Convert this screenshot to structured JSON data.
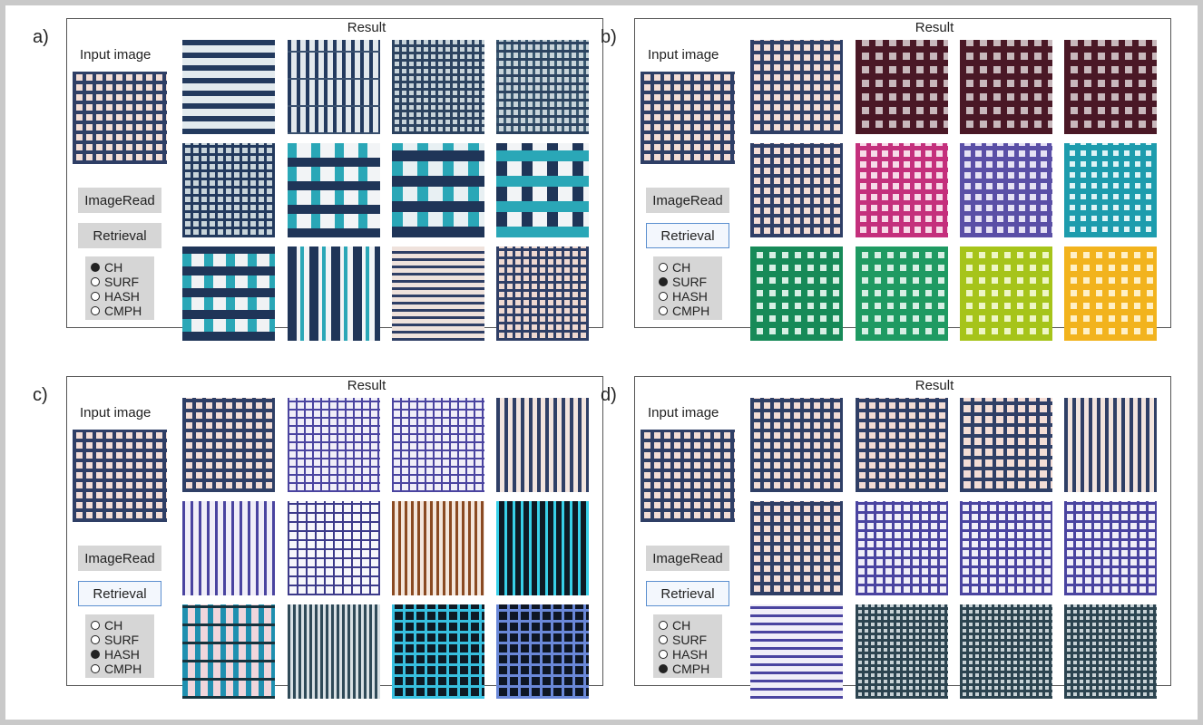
{
  "result_label": "Result",
  "input_label": "Input image",
  "imageread_label": "ImageRead",
  "retrieval_label": "Retrieval",
  "methods": [
    "CH",
    "SURF",
    "HASH",
    "CMPH"
  ],
  "input_pattern": {
    "bg": "#f3ddd6",
    "h": "#2f3f66",
    "v": "#2f3f66",
    "hs": 11,
    "vs": 11,
    "hw": 4,
    "vw": 4
  },
  "panels": [
    {
      "letter": "a)",
      "selected_method": "CH",
      "retrieval_active": false,
      "results": [
        {
          "bg": "#e2eaee",
          "h": "#233a5e",
          "v": null,
          "hs": 14,
          "hw": 6
        },
        {
          "bg": "#e2e8ec",
          "h": "#39506e",
          "v": "#233a5e",
          "hs": 30,
          "vs": 10,
          "hw": 2,
          "vw": 4
        },
        {
          "bg": "#c8d4da",
          "h": "#2c4360",
          "v": "#2c4360",
          "hs": 8,
          "vs": 8,
          "hw": 3,
          "vw": 3
        },
        {
          "bg": "#c8d4da",
          "h": "#2c4360",
          "v": "#3a5870",
          "hs": 9,
          "vs": 8,
          "hw": 3,
          "vw": 3
        },
        {
          "bg": "#c8d4da",
          "h": "#233a5e",
          "v": "#233a5e",
          "hs": 9,
          "vs": 9,
          "hw": 3,
          "vw": 3
        },
        {
          "bg": "#f2f4f6",
          "h": "#1f3558",
          "v": "#2aa7b7",
          "hs": 26,
          "vs": 26,
          "hw": 10,
          "vw": 10
        },
        {
          "bg": "#e8f0f3",
          "h": "#1f3558",
          "v": "#2aa7b7",
          "hs": 28,
          "vs": 28,
          "hw": 12,
          "vw": 12
        },
        {
          "bg": "#f2f4f6",
          "h": "#2aa7b7",
          "v": "#1f3558",
          "hs": 28,
          "vs": 28,
          "hw": 12,
          "vw": 12
        },
        {
          "bg": "#f0f2f4",
          "h": "#1f3558",
          "v": "#2aa7b7",
          "hs": 24,
          "vs": 24,
          "hw": 10,
          "vw": 10
        },
        {
          "bg": "#f2f4f6",
          "h": null,
          "v": "#1f3558",
          "vs": 24,
          "vw": 10,
          "accent": "#2aa7b7"
        },
        {
          "bg": "#efe2dc",
          "h": "#2f3f66",
          "v": null,
          "hs": 8,
          "hw": 3
        },
        {
          "bg": "#efd9d1",
          "h": "#2f3f66",
          "v": "#2f3f66",
          "hs": 9,
          "vs": 9,
          "hw": 3,
          "vw": 3
        }
      ]
    },
    {
      "letter": "b)",
      "selected_method": "SURF",
      "retrieval_active": true,
      "results": [
        {
          "bg": "#f3ddd6",
          "h": "#2f3f66",
          "v": "#2f3f66",
          "hs": 11,
          "vs": 11,
          "hw": 4,
          "vw": 4
        },
        {
          "bg": "#c8b8bc",
          "h": "#4a1826",
          "v": "#4a1826",
          "hs": 15,
          "vs": 15,
          "hw": 7,
          "vw": 7
        },
        {
          "bg": "#c8b8bc",
          "h": "#4a1826",
          "v": "#4a1826",
          "hs": 15,
          "vs": 15,
          "hw": 7,
          "vw": 7
        },
        {
          "bg": "#c8b8bc",
          "h": "#4a1826",
          "v": "#4a1826",
          "hs": 15,
          "vs": 15,
          "hw": 7,
          "vw": 7
        },
        {
          "bg": "#f3ddd6",
          "h": "#2f3f66",
          "v": "#2f3f66",
          "hs": 11,
          "vs": 11,
          "hw": 4,
          "vw": 4
        },
        {
          "bg": "#f7dbe8",
          "h": "#c4307c",
          "v": "#c4307c",
          "hs": 12,
          "vs": 12,
          "hw": 5,
          "vw": 5
        },
        {
          "bg": "#e6e2f4",
          "h": "#5a4fa6",
          "v": "#5a4fa6",
          "hs": 12,
          "vs": 12,
          "hw": 5,
          "vw": 5
        },
        {
          "bg": "#dff4f6",
          "h": "#1d9cad",
          "v": "#1d9cad",
          "hs": 12,
          "vs": 12,
          "hw": 6,
          "vw": 6
        },
        {
          "bg": "#d7efe4",
          "h": "#178a58",
          "v": "#178a58",
          "hs": 14,
          "vs": 14,
          "hw": 7,
          "vw": 7
        },
        {
          "bg": "#d7efe4",
          "h": "#1f9a62",
          "v": "#1f9a62",
          "hs": 14,
          "vs": 14,
          "hw": 7,
          "vw": 7
        },
        {
          "bg": "#eef6c6",
          "h": "#a6c41a",
          "v": "#a6c41a",
          "hs": 14,
          "vs": 14,
          "hw": 7,
          "vw": 7
        },
        {
          "bg": "#fff0c6",
          "h": "#f2b31d",
          "v": "#f2b31d",
          "hs": 14,
          "vs": 14,
          "hw": 7,
          "vw": 7
        }
      ]
    },
    {
      "letter": "c)",
      "selected_method": "HASH",
      "retrieval_active": true,
      "results": [
        {
          "bg": "#f3ddd6",
          "h": "#2f3f66",
          "v": "#2f3f66",
          "hs": 11,
          "vs": 11,
          "hw": 4,
          "vw": 4
        },
        {
          "bg": "#f0eef8",
          "h": "#4a44a0",
          "v": "#4a44a0",
          "hs": 9,
          "vs": 9,
          "hw": 2,
          "vw": 2
        },
        {
          "bg": "#f0eef8",
          "h": "#4a44a0",
          "v": "#4a44a0",
          "hs": 9,
          "vs": 9,
          "hw": 2,
          "vw": 2
        },
        {
          "bg": "#f2e4de",
          "h": null,
          "v": "#2f3f66",
          "vs": 9,
          "vw": 4
        },
        {
          "bg": "#f0eef8",
          "h": null,
          "v": "#4a44a0",
          "vs": 9,
          "vw": 3
        },
        {
          "bg": "#f6f6fb",
          "h": "#3c3a8a",
          "v": "#3c3a8a",
          "hs": 10,
          "vs": 10,
          "hw": 2,
          "vw": 2
        },
        {
          "bg": "#f3e6dc",
          "h": null,
          "v": "#8a4a22",
          "vs": 7,
          "vw": 3
        },
        {
          "bg": "#0e1a24",
          "h": null,
          "v": "#38d0e8",
          "vs": 9,
          "vw": 3
        },
        {
          "bg": "#f0d6dc",
          "h": "#16333e",
          "v": "#1f90b0",
          "hs": 20,
          "vs": 14,
          "hw": 3,
          "vw": 6
        },
        {
          "bg": "#d8e0e4",
          "h": null,
          "v": "#2f4a58",
          "vs": 6,
          "vw": 3
        },
        {
          "bg": "#0e1a24",
          "h": "#38c0e0",
          "v": "#38c0e0",
          "hs": 12,
          "vs": 12,
          "hw": 3,
          "vw": 3
        },
        {
          "bg": "#0e1624",
          "h": "#6a88d8",
          "v": "#6a88d8",
          "hs": 12,
          "vs": 12,
          "hw": 3,
          "vw": 3
        }
      ]
    },
    {
      "letter": "d)",
      "selected_method": "CMPH",
      "retrieval_active": true,
      "results": [
        {
          "bg": "#f3ddd6",
          "h": "#2f3f66",
          "v": "#2f3f66",
          "hs": 11,
          "vs": 11,
          "hw": 4,
          "vw": 4
        },
        {
          "bg": "#f3ddd6",
          "h": "#2f3f66",
          "v": "#2f3f66",
          "hs": 11,
          "vs": 11,
          "hw": 4,
          "vw": 4
        },
        {
          "bg": "#f3ddd6",
          "h": "#2f3f66",
          "v": "#2f3f66",
          "hs": 12,
          "vs": 12,
          "hw": 4,
          "vw": 4
        },
        {
          "bg": "#f2e4de",
          "h": null,
          "v": "#2f3f66",
          "vs": 9,
          "vw": 4
        },
        {
          "bg": "#f3ddd6",
          "h": "#2f3f66",
          "v": "#2f3f66",
          "hs": 11,
          "vs": 11,
          "hw": 4,
          "vw": 4
        },
        {
          "bg": "#f0eef8",
          "h": "#4a44a0",
          "v": "#4a44a0",
          "hs": 10,
          "vs": 10,
          "hw": 3,
          "vw": 3
        },
        {
          "bg": "#f0eef8",
          "h": "#4a44a0",
          "v": "#4a44a0",
          "hs": 10,
          "vs": 10,
          "hw": 3,
          "vw": 3
        },
        {
          "bg": "#f0eef8",
          "h": "#4a44a0",
          "v": "#4a44a0",
          "hs": 10,
          "vs": 10,
          "hw": 3,
          "vw": 3
        },
        {
          "bg": "#f0eef8",
          "h": "#4a44a0",
          "v": null,
          "hs": 9,
          "hw": 3
        },
        {
          "bg": "#c8d2d6",
          "h": "#2c4450",
          "v": "#2c4450",
          "hs": 7,
          "vs": 7,
          "hw": 3,
          "vw": 3
        },
        {
          "bg": "#c8d2d6",
          "h": "#2c4450",
          "v": "#2c4450",
          "hs": 7,
          "vs": 7,
          "hw": 3,
          "vw": 3
        },
        {
          "bg": "#c8d2d6",
          "h": "#2c4450",
          "v": "#2c4450",
          "hs": 7,
          "vs": 7,
          "hw": 3,
          "vw": 3
        }
      ]
    }
  ]
}
